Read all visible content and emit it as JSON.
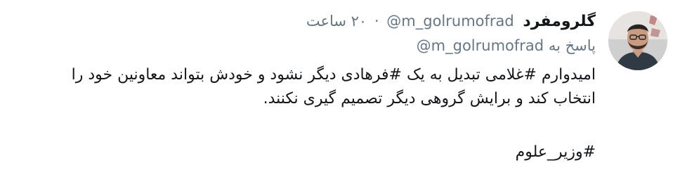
{
  "tweet": {
    "display_name": "گلرومفرد",
    "handle": "@m_golrumofrad",
    "separator": "·",
    "time": "۲۰ ساعت",
    "reply_prefix": "پاسخ به",
    "reply_handle": "@m_golrumofrad",
    "body_line_1": "امیدوارم #غلامی تبدیل به یک #فرهادی دیگر نشود و خودش بتواند معاونین خود را",
    "body_line_2": "انتخاب کند و برایش گروهی دیگر تصمیم گیری نکنند.",
    "hashtag_line": "#وزیر_علوم"
  },
  "colors": {
    "text": "#14171a",
    "muted": "#657786",
    "background": "#ffffff"
  },
  "icons": {
    "avatar": "profile-photo"
  }
}
